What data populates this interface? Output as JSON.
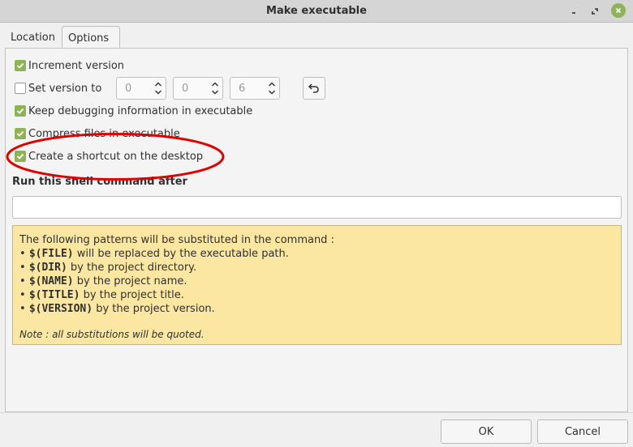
{
  "window": {
    "title": "Make executable",
    "controls": [
      "minimize-icon",
      "maximize-icon",
      "close-icon"
    ]
  },
  "tabs": [
    {
      "label": "Location",
      "active": false
    },
    {
      "label": "Options",
      "active": true
    }
  ],
  "options": {
    "increment_version": {
      "label": "Increment version",
      "checked": true
    },
    "set_version": {
      "label": "Set version to",
      "checked": false
    },
    "version_fields": [
      "0",
      "0",
      "6"
    ],
    "reset_icon": "undo-icon",
    "keep_debug": {
      "label": "Keep debugging information in executable",
      "checked": true
    },
    "compress_files": {
      "label": "Compress files in executable",
      "checked": true
    },
    "create_shortcut": {
      "label": "Create a shortcut on the desktop",
      "checked": true
    }
  },
  "shell_command": {
    "label": "Run this shell command after",
    "value": ""
  },
  "patterns_help": {
    "intro": "The following patterns will be substituted in the command :",
    "items": [
      {
        "bullet": "•",
        "token": "$(FILE)",
        "text": " will be replaced by the executable path."
      },
      {
        "bullet": "•",
        "token": "$(DIR)",
        "text": " by the project directory."
      },
      {
        "bullet": "•",
        "token": "$(NAME)",
        "text": " by the project name."
      },
      {
        "bullet": "•",
        "token": "$(TITLE)",
        "text": " by the project title."
      },
      {
        "bullet": "•",
        "token": "$(VERSION)",
        "text": " by the project version."
      }
    ],
    "note": "Note : all substitutions will be quoted."
  },
  "buttons": {
    "ok": "OK",
    "cancel": "Cancel"
  },
  "colors": {
    "accent_green": "#8fb359",
    "highlight_red": "#e00000",
    "hint_bg": "#fce7a2"
  }
}
